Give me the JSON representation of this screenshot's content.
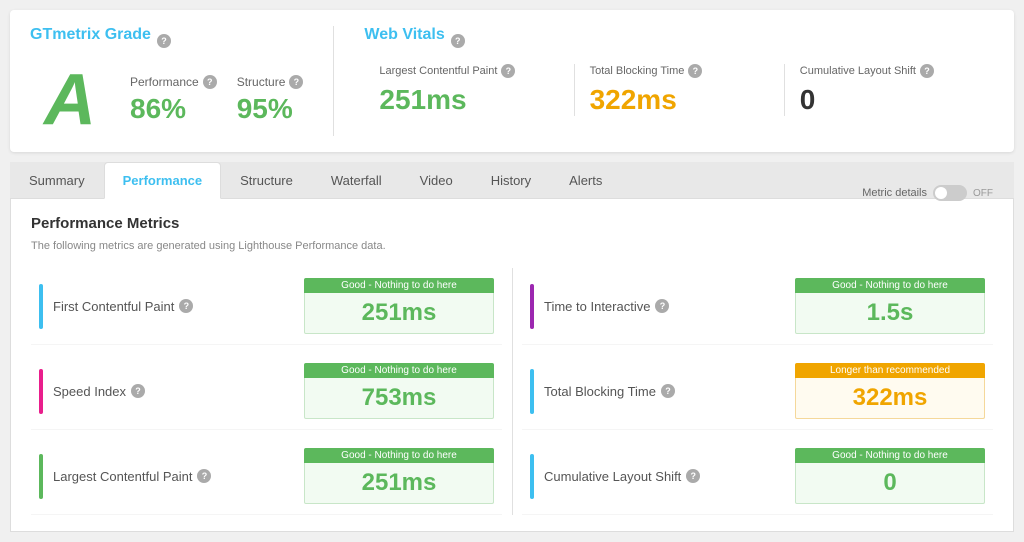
{
  "header": {
    "gtmetrix_title": "GTmetrix Grade",
    "web_vitals_title": "Web Vitals",
    "grade": "A",
    "performance_label": "Performance",
    "performance_value": "86%",
    "structure_label": "Structure",
    "structure_value": "95%",
    "lcp_label": "Largest Contentful Paint",
    "lcp_value": "251ms",
    "tbt_label": "Total Blocking Time",
    "tbt_value": "322ms",
    "cls_label": "Cumulative Layout Shift",
    "cls_value": "0"
  },
  "tabs": [
    {
      "label": "Summary",
      "active": false
    },
    {
      "label": "Performance",
      "active": true
    },
    {
      "label": "Structure",
      "active": false
    },
    {
      "label": "Waterfall",
      "active": false
    },
    {
      "label": "Video",
      "active": false
    },
    {
      "label": "History",
      "active": false
    },
    {
      "label": "Alerts",
      "active": false
    }
  ],
  "performance": {
    "title": "Performance Metrics",
    "subtitle": "The following metrics are generated using Lighthouse Performance data.",
    "metric_details_label": "Metric details",
    "toggle_label": "OFF",
    "metrics": [
      {
        "name": "First Contentful Paint",
        "bar_color": "bar-blue",
        "badge": "Good - Nothing to do here",
        "badge_type": "green",
        "value": "251ms",
        "value_type": "green"
      },
      {
        "name": "Time to Interactive",
        "bar_color": "bar-purple",
        "badge": "Good - Nothing to do here",
        "badge_type": "green",
        "value": "1.5s",
        "value_type": "green"
      },
      {
        "name": "Speed Index",
        "bar_color": "bar-pink",
        "badge": "Good - Nothing to do here",
        "badge_type": "green",
        "value": "753ms",
        "value_type": "green"
      },
      {
        "name": "Total Blocking Time",
        "bar_color": "bar-blue",
        "badge": "Longer than recommended",
        "badge_type": "orange",
        "value": "322ms",
        "value_type": "orange"
      },
      {
        "name": "Largest Contentful Paint",
        "bar_color": "bar-green",
        "badge": "Good - Nothing to do here",
        "badge_type": "green",
        "value": "251ms",
        "value_type": "green"
      },
      {
        "name": "Cumulative Layout Shift",
        "bar_color": "bar-blue",
        "badge": "Good - Nothing to do here",
        "badge_type": "green",
        "value": "0",
        "value_type": "green"
      }
    ]
  }
}
